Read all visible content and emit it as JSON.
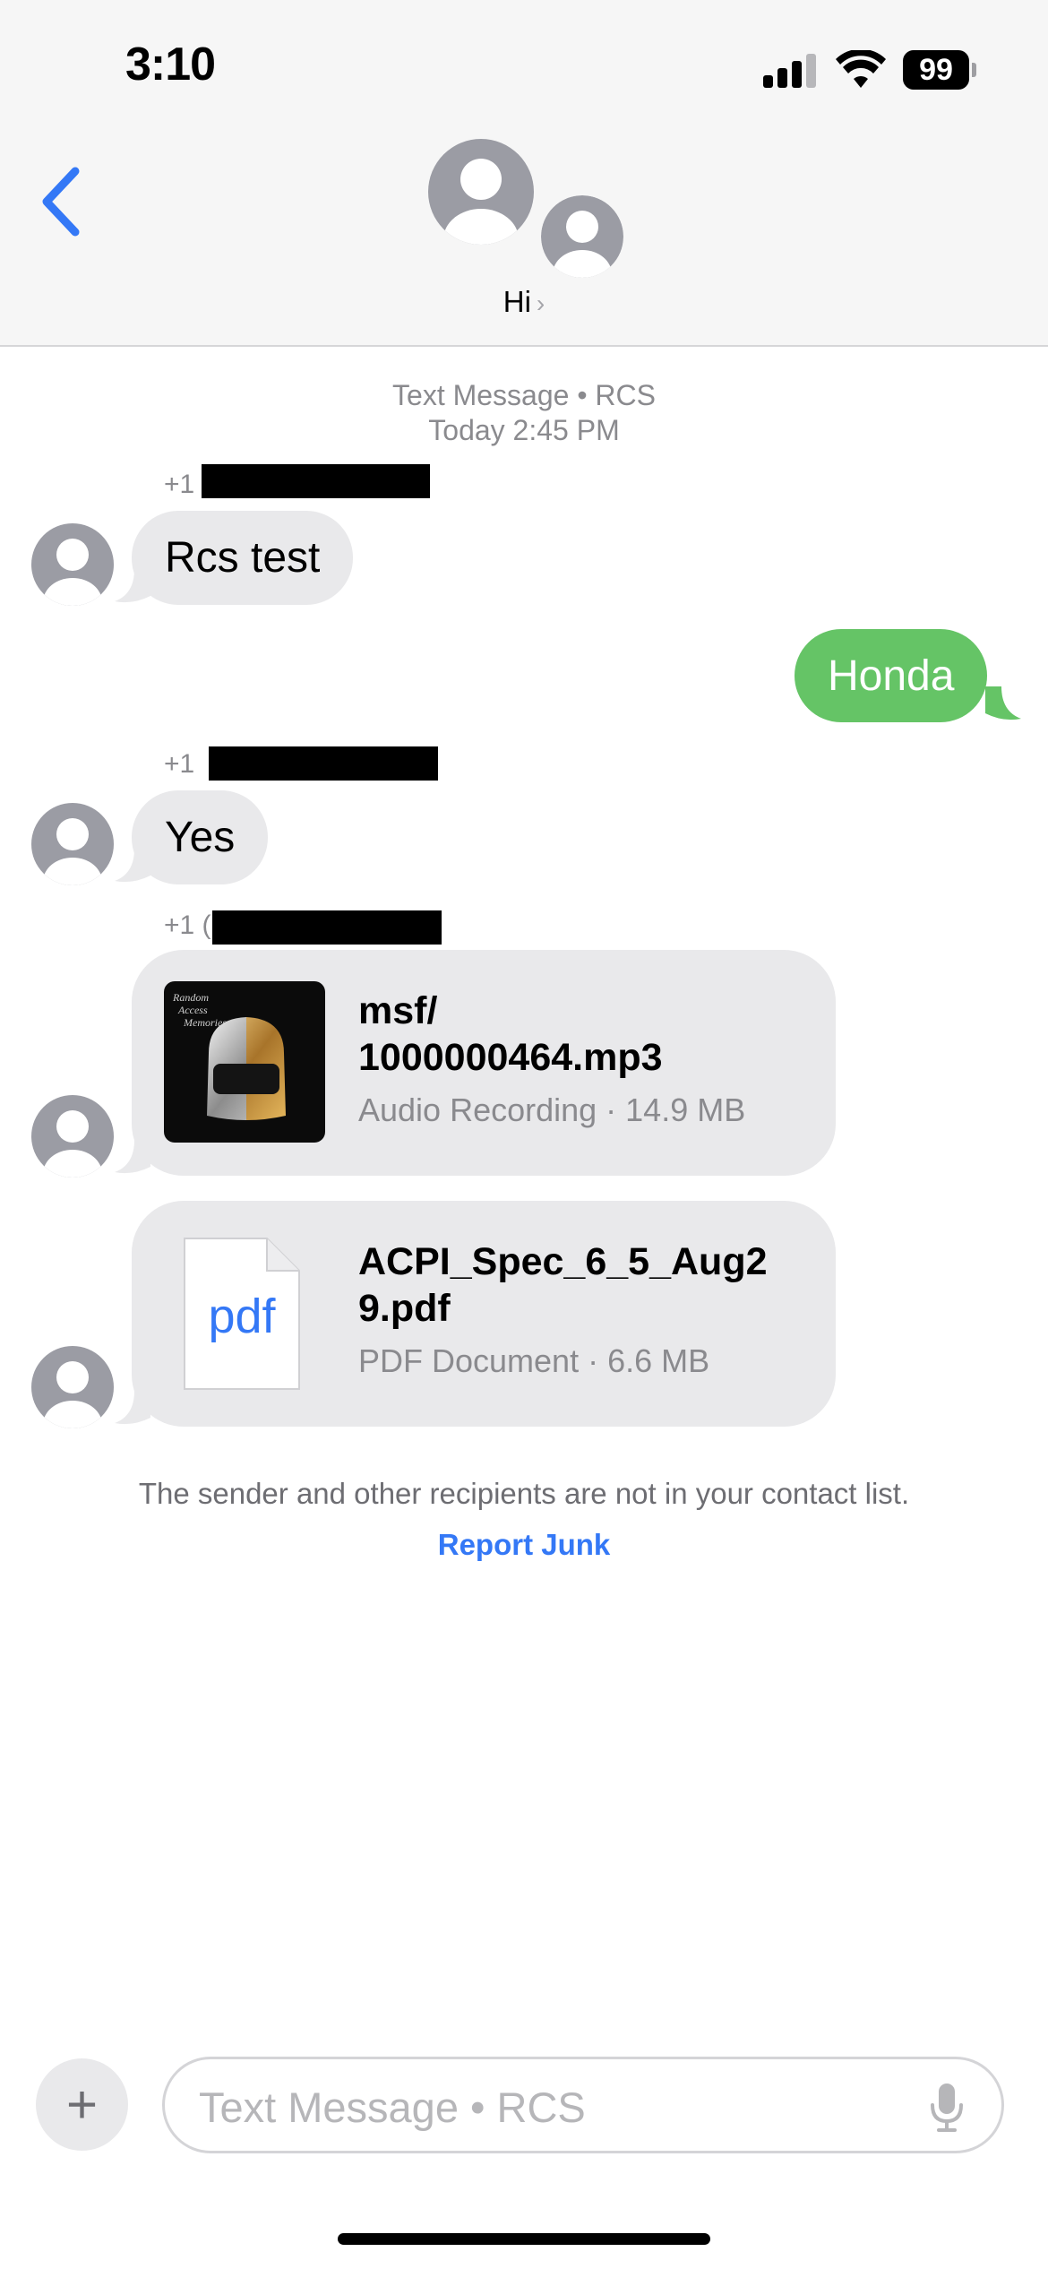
{
  "status_bar": {
    "time": "3:10",
    "battery": "99"
  },
  "header": {
    "contact_name": "Hi",
    "name_chevron": "›"
  },
  "conversation": {
    "service_label": "Text Message • RCS",
    "timestamp": "Today 2:45 PM",
    "messages": [
      {
        "sender_prefix": "+1",
        "text": "Rcs test",
        "direction": "incoming"
      },
      {
        "text": "Honda",
        "direction": "outgoing"
      },
      {
        "sender_prefix": "+1",
        "text": "Yes",
        "direction": "incoming"
      }
    ],
    "attachments": {
      "sender_prefix": "+1 (",
      "items": [
        {
          "title_line1": "msf/",
          "title_line2": "1000000464.mp3",
          "subtitle": "Audio Recording · 14.9 MB",
          "icon": "album-art"
        },
        {
          "title_line1": "ACPI_Spec_6_5_Aug2",
          "title_line2": "9.pdf",
          "subtitle": "PDF Document · 6.6 MB",
          "icon": "pdf-file-icon",
          "icon_label": "pdf"
        }
      ]
    },
    "notice": "The sender and other recipients are not in your contact list.",
    "report_link": "Report Junk"
  },
  "composer": {
    "placeholder": "Text Message • RCS",
    "plus": "+"
  },
  "colors": {
    "outgoing_bubble": "#65c466",
    "incoming_bubble": "#e9e9eb",
    "accent": "#3478f6"
  }
}
